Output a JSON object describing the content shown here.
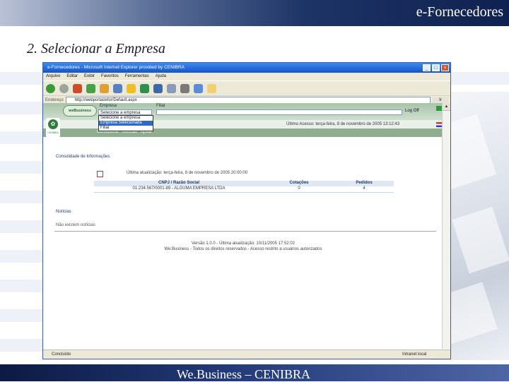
{
  "header": {
    "brand": "e-Fornecedores"
  },
  "slide": {
    "title": "2.   Selecionar a Empresa"
  },
  "footer": {
    "text": "We.Business – CENIBRA"
  },
  "browser": {
    "window_title": "e-Fornecedores - Microsoft Internet Explorer provided by CENIBRA",
    "menu": [
      "Arquivo",
      "Editar",
      "Exibir",
      "Favoritos",
      "Ferramentas",
      "Ajuda"
    ],
    "address_label": "Endereço",
    "address_value": "http://webportal/efor/Default.aspx",
    "go_label": "Ir",
    "status_left": "Concluído",
    "status_right": "Intranet local"
  },
  "app": {
    "logo_text": "weBusiness",
    "company_label": "Empresa",
    "company_selected": "Selecione a empresa",
    "filial_label": "Filial",
    "logoff_label": "Log Off",
    "dropdown_options": [
      "Selecione a empresa",
      "Empresa Selecionada",
      "Filial"
    ],
    "cenibra_label": "CENIBRA",
    "last_access": "Último Acesso: terça-feira, 8 de novembro de 2005 13:12:43",
    "nav": [
      "Consultoria",
      "Notícias",
      "Ajuda"
    ],
    "summary_title": "Consolidade de Informações",
    "summary_note": "Última atualização: terça-feira, 8 de novembro de 2005 20:00:00",
    "table": {
      "headers": [
        "CNPJ / Razão Social",
        "Cotações",
        "Pedidos"
      ],
      "rows": [
        [
          "01.234.567/0001-89 - ALGUMA EMPRESA LTDA",
          "0",
          "4"
        ]
      ]
    },
    "news_title": "Notícias",
    "news_item": "Não existem notícias",
    "footer_line1": "Versão 1.0.0 - Última atualização: 10/11/2005 17:52:02",
    "footer_line2": "We.Business - Todos os direitos reservados - Acesso restrito a usuários autorizados"
  },
  "colors": {
    "brand_navy": "#1d3466",
    "ie_blue": "#1553c9",
    "app_green": "#8fae8f"
  }
}
